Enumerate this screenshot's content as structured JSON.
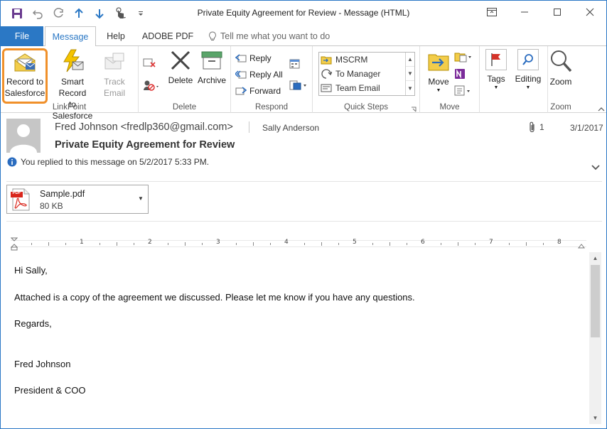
{
  "window": {
    "title": "Private Equity Agreement for Review  -  Message (HTML)"
  },
  "quick_access": {
    "icons": [
      "save-icon",
      "undo-icon",
      "redo-icon",
      "up-arrow-icon",
      "down-arrow-icon",
      "touch-mode-icon",
      "customize-icon"
    ]
  },
  "tabs": {
    "file": "File",
    "message": "Message",
    "help": "Help",
    "adobe_pdf": "ADOBE PDF",
    "tell_me": "Tell me what you want to do"
  },
  "ribbon": {
    "linkpoint": {
      "label": "LinkPoint",
      "record_line1": "Record to",
      "record_line2": "Salesforce",
      "smart_line1": "Smart Record",
      "smart_line2": "to Salesforce",
      "track_line1": "Track",
      "track_line2": "Email"
    },
    "delete": {
      "label": "Delete",
      "delete_btn": "Delete",
      "archive_btn": "Archive"
    },
    "respond": {
      "label": "Respond",
      "reply": "Reply",
      "reply_all": "Reply All",
      "forward": "Forward"
    },
    "quick_steps": {
      "label": "Quick Steps",
      "items": [
        "MSCRM",
        "To Manager",
        "Team Email"
      ]
    },
    "move": {
      "label": "Move",
      "move_btn": "Move"
    },
    "tags": {
      "tags_btn": "Tags",
      "editing_btn": "Editing"
    },
    "zoom": {
      "label": "Zoom",
      "zoom_btn": "Zoom"
    }
  },
  "message": {
    "from": "Fred Johnson <fredlp360@gmail.com>",
    "to": "Sally Anderson",
    "attachment_count": "1",
    "date": "3/1/2017",
    "subject": "Private Equity Agreement for Review",
    "info": "You replied to this message on 5/2/2017 5:33 PM."
  },
  "attachment": {
    "name": "Sample.pdf",
    "size": "80 KB",
    "icon_text": "PDF"
  },
  "ruler": {
    "numbers": [
      "1",
      "2",
      "3",
      "4",
      "5",
      "6",
      "7",
      "8"
    ]
  },
  "body": {
    "greeting": "Hi Sally,",
    "line1": "Attached is a copy of the agreement we discussed. Please let me know if you have any questions.",
    "closing": "Regards,",
    "name": "Fred Johnson",
    "title": "President & COO"
  },
  "colors": {
    "accent": "#2b78c5",
    "highlight": "#f0902a",
    "pdf_red": "#d9261c"
  }
}
